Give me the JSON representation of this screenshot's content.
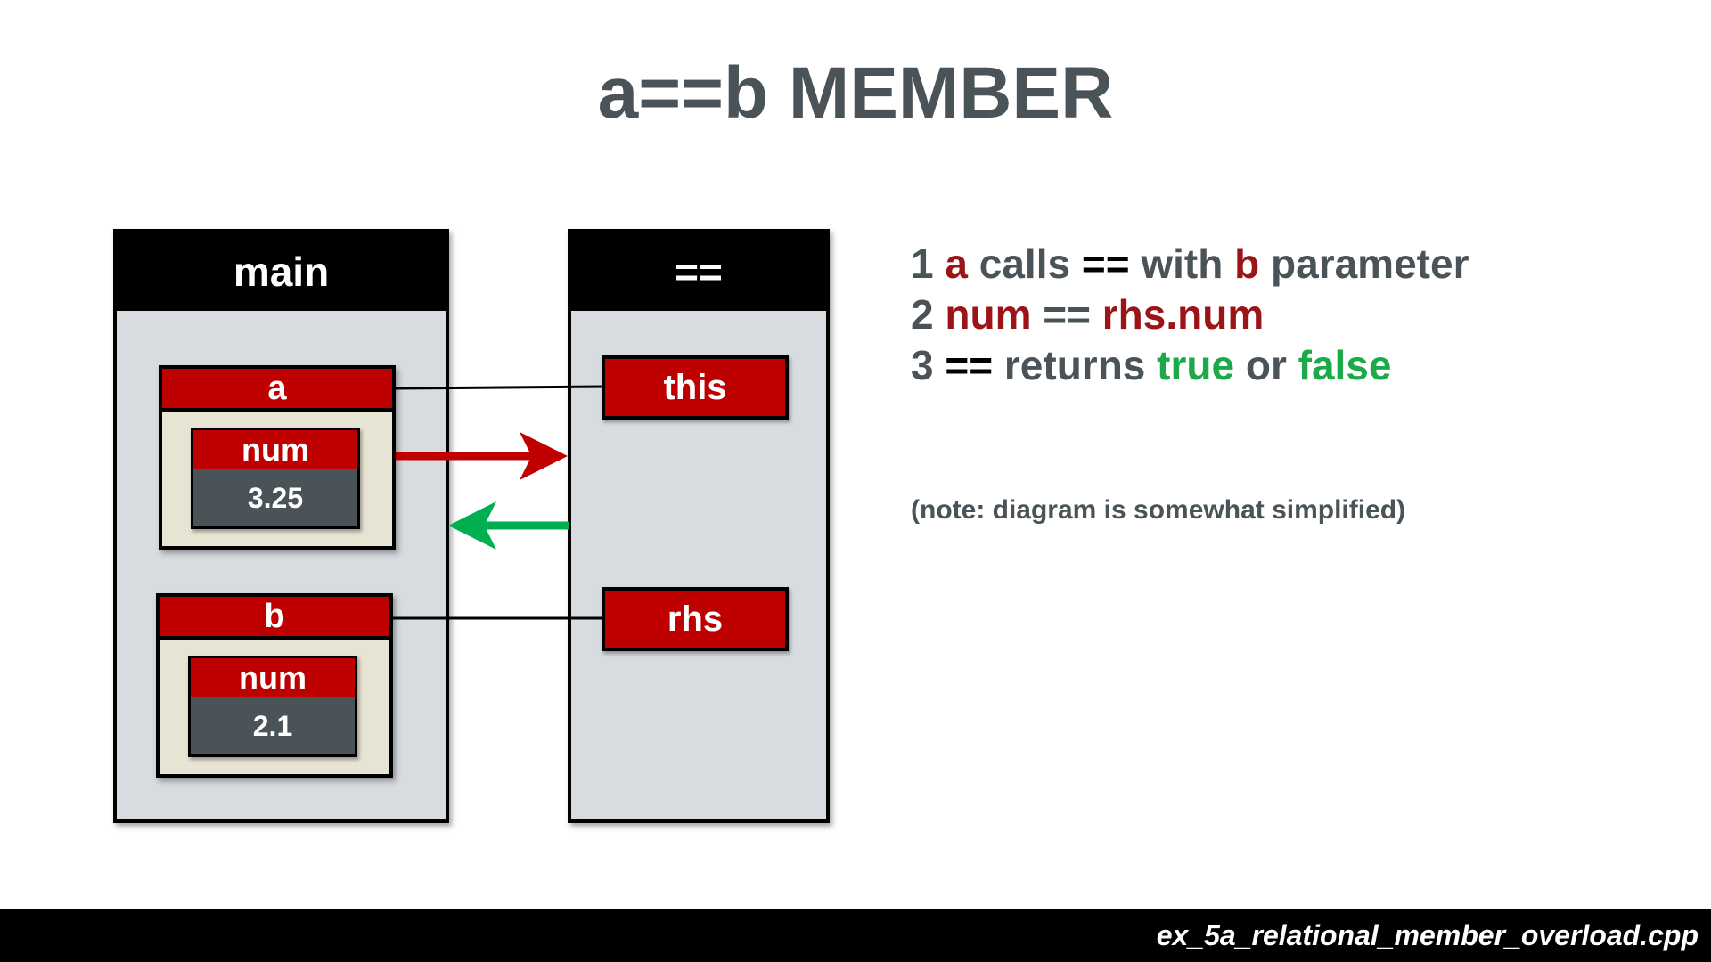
{
  "title": "a==b MEMBER",
  "frames": {
    "main": {
      "label": "main"
    },
    "op": {
      "label": "=="
    }
  },
  "objects": {
    "a": {
      "label": "a",
      "field_name": "num",
      "field_value": "3.25"
    },
    "b": {
      "label": "b",
      "field_name": "num",
      "field_value": "2.1"
    }
  },
  "refs": {
    "this": "this",
    "rhs": "rhs"
  },
  "notes": {
    "line1": {
      "n": "1 ",
      "a": "a",
      "calls": " calls ",
      "op": "==",
      "with": " with ",
      "b": "b",
      "param": " parameter"
    },
    "line2": {
      "n": "2 ",
      "num": "num",
      "op": " == ",
      "rhs": "rhs.num"
    },
    "line3": {
      "n": "3 ",
      "op": "==",
      "returns": " returns ",
      "true": "true",
      "or": " or ",
      "false": "false"
    }
  },
  "aside": "(note: diagram is somewhat simplified)",
  "footer": {
    "filename": "ex_5a_relational_member_overload.cpp"
  },
  "colors": {
    "frame_bg": "#d8dce0",
    "header_bg": "#000000",
    "label_red": "#bf0000",
    "value_bg": "#4a5357",
    "object_bg": "#e8e4d4",
    "text_gray": "#4a5357",
    "text_red": "#9b1418",
    "text_green": "#1aaa4a",
    "arrow_red": "#c00000",
    "arrow_green": "#00b050"
  }
}
